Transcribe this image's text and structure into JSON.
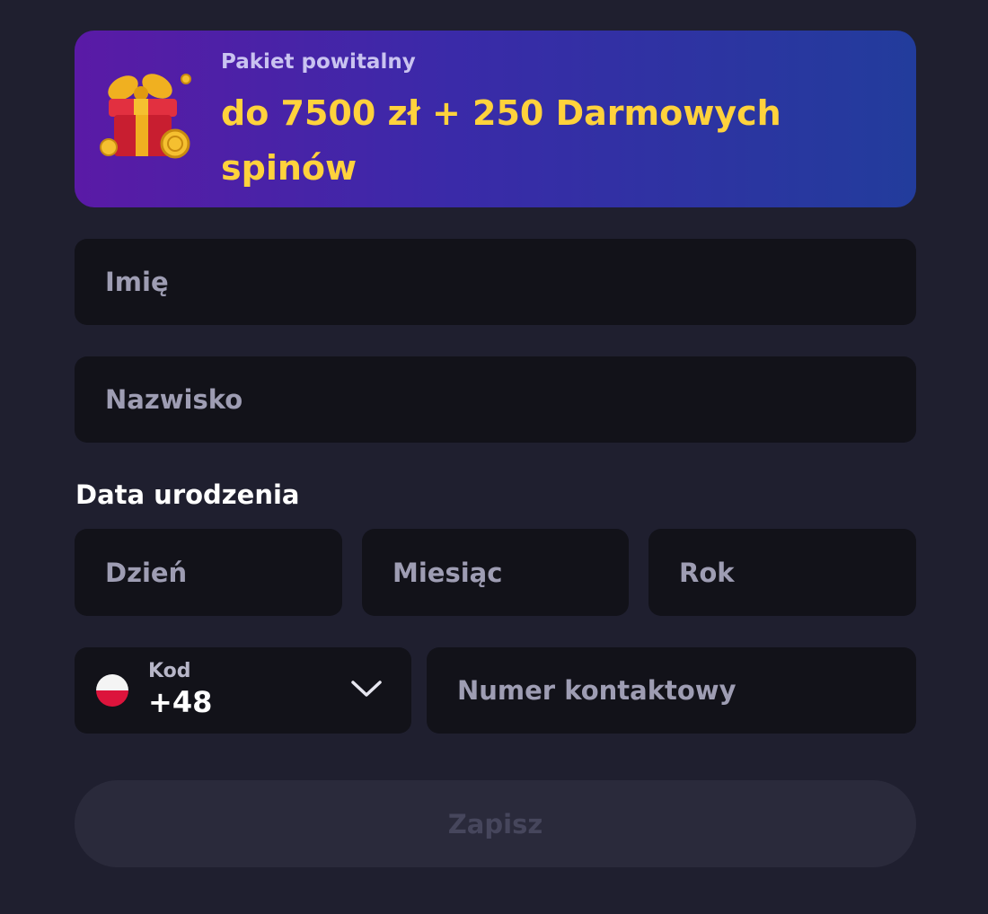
{
  "banner": {
    "subtitle": "Pakiet powitalny",
    "title": "do 7500 zł + 250 Darmowych spinów",
    "gradient_colors": [
      "#5a1aa6",
      "#3a2aa8",
      "#223c9c"
    ],
    "title_color": "#ffd23c",
    "icon": "gift-with-coins-icon"
  },
  "form": {
    "first_name": {
      "placeholder": "Imię",
      "value": ""
    },
    "last_name": {
      "placeholder": "Nazwisko",
      "value": ""
    },
    "birth_date": {
      "label": "Data urodzenia",
      "day": {
        "placeholder": "Dzień",
        "value": ""
      },
      "month": {
        "placeholder": "Miesiąc",
        "value": ""
      },
      "year": {
        "placeholder": "Rok",
        "value": ""
      }
    },
    "phone": {
      "code_label": "Kod",
      "code_value": "+48",
      "country_flag": "poland-flag-icon",
      "dropdown_icon": "chevron-down-icon",
      "number": {
        "placeholder": "Numer kontaktowy",
        "value": ""
      }
    },
    "submit_label": "Zapisz"
  },
  "colors": {
    "background": "#1f1f2f",
    "field_background": "#121219",
    "placeholder": "#9e9db3",
    "button_disabled_bg": "#2a2a3b",
    "button_disabled_text": "#46465c"
  }
}
